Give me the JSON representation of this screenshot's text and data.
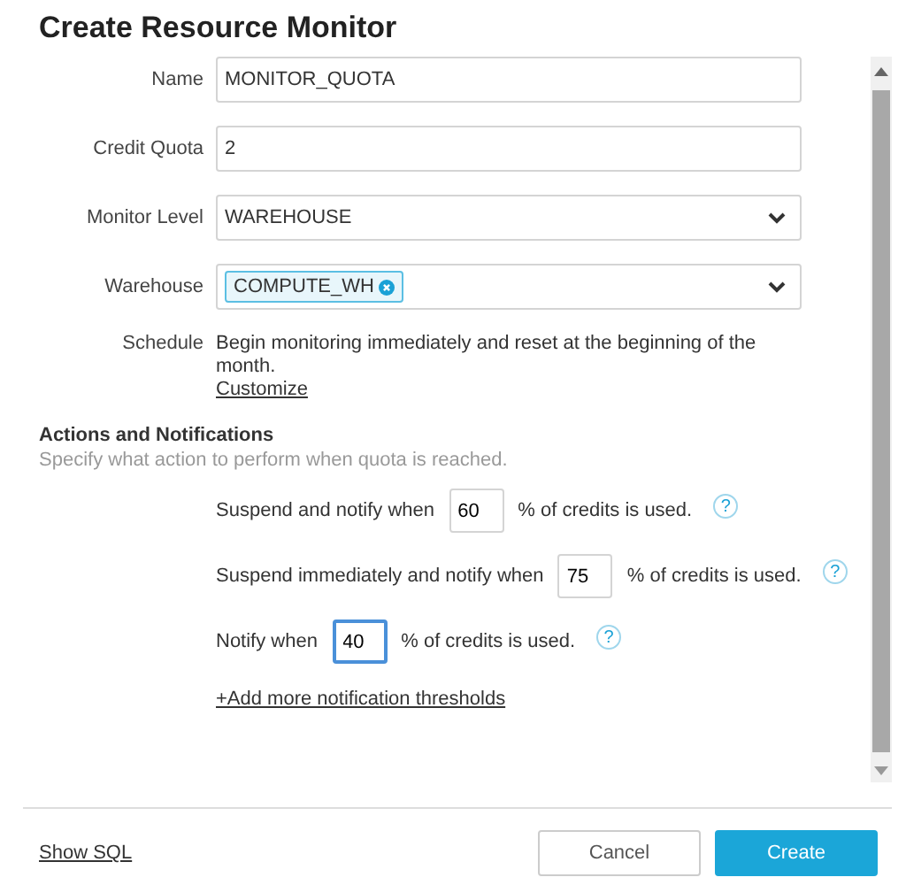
{
  "dialog": {
    "title": "Create Resource Monitor"
  },
  "fields": [
    {
      "label": "Name",
      "kind": "text",
      "value": "MONITOR_QUOTA"
    },
    {
      "label": "Credit Quota",
      "kind": "text",
      "value": "2"
    },
    {
      "label": "Monitor Level",
      "kind": "select",
      "value": "WAREHOUSE"
    },
    {
      "label": "Warehouse",
      "kind": "tags",
      "tags": [
        "COMPUTE_WH"
      ]
    }
  ],
  "schedule": {
    "label": "Schedule",
    "text": "Begin monitoring immediately and reset at the beginning of the month.",
    "link": "Customize"
  },
  "actions": {
    "heading": "Actions and Notifications",
    "description": "Specify what action to perform when quota is reached.",
    "thresholds": [
      {
        "before": "Suspend and notify when",
        "value": "60",
        "after": "% of credits is used.",
        "focused": false,
        "help": "?"
      },
      {
        "before": "Suspend immediately and notify when",
        "value": "75",
        "after": "% of credits is used.",
        "focused": false,
        "help": "?"
      },
      {
        "before": "Notify when",
        "value": "40",
        "after": "% of credits is used.",
        "focused": true,
        "help": "?"
      }
    ],
    "add_link": "+Add more notification thresholds"
  },
  "footer": {
    "link": "Show SQL",
    "buttons": [
      {
        "label": "Cancel",
        "kind": "secondary"
      },
      {
        "label": "Create",
        "kind": "primary"
      }
    ]
  }
}
